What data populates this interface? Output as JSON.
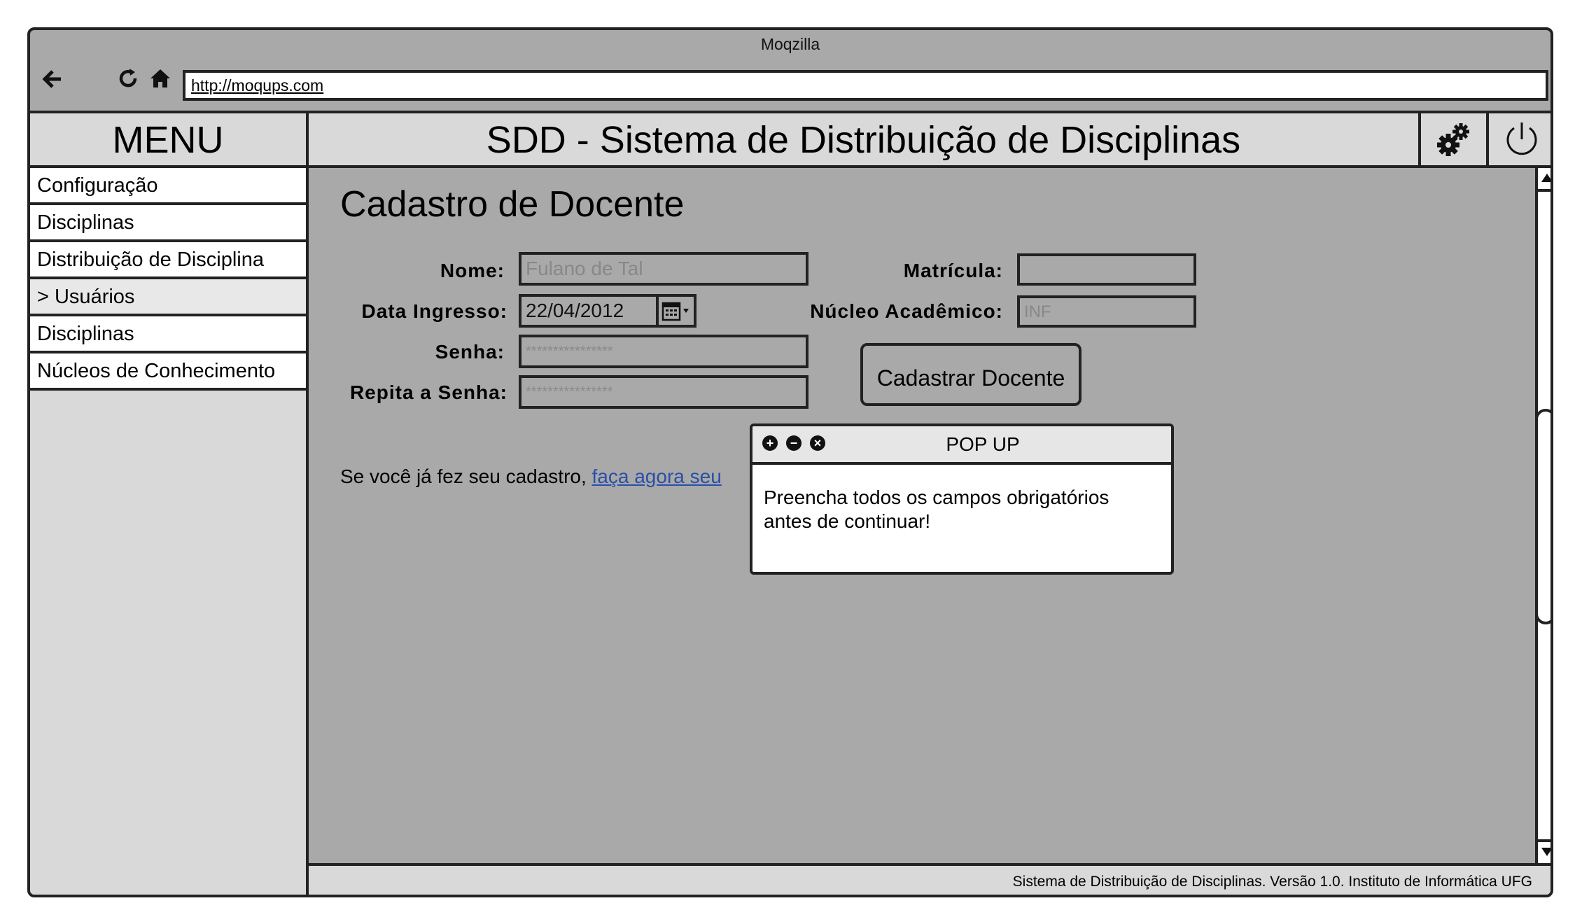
{
  "browser": {
    "title": "Moqzilla",
    "url": "http://moqups.com",
    "back_icon": "arrow-left-icon",
    "reload_icon": "reload-icon",
    "home_icon": "home-icon"
  },
  "menu": {
    "title": "MENU",
    "items": [
      {
        "label": "Configuração"
      },
      {
        "label": "Disciplinas"
      },
      {
        "label": "Distribuição de Disciplina"
      },
      {
        "label": "> Usuários"
      },
      {
        "label": "Disciplinas"
      },
      {
        "label": "Núcleos de Conhecimento"
      }
    ]
  },
  "header": {
    "title": "SDD - Sistema de Distribuição de Disciplinas",
    "settings_icon": "gears-icon",
    "power_icon": "power-icon"
  },
  "form": {
    "title": "Cadastro de Docente",
    "nome_label": "Nome:",
    "nome_placeholder": "Fulano de Tal",
    "matricula_label": "Matrícula:",
    "matricula_value": "",
    "data_label": "Data Ingresso:",
    "data_value": "22/04/2012",
    "nucleo_label": "Núcleo Acadêmico:",
    "nucleo_placeholder": "INF",
    "senha_label": "Senha:",
    "senha_value": "****************",
    "repita_label": "Repita a Senha:",
    "repita_value": "****************",
    "submit_label": "Cadastrar Docente",
    "login_prefix": "Se você já fez seu cadastro, ",
    "login_link": "faça agora seu"
  },
  "popup": {
    "title": "POP UP",
    "message_line1": "Preencha todos os campos obrigatórios",
    "message_line2": "antes de continuar!"
  },
  "footer": {
    "text": "Sistema de Distribuição de Disciplinas. Versão 1.0. Instituto de Informática UFG"
  },
  "colors": {
    "content_bg": "#a9a9a9",
    "panel_bg": "#d9d9d9",
    "link": "#2a4fa8"
  }
}
